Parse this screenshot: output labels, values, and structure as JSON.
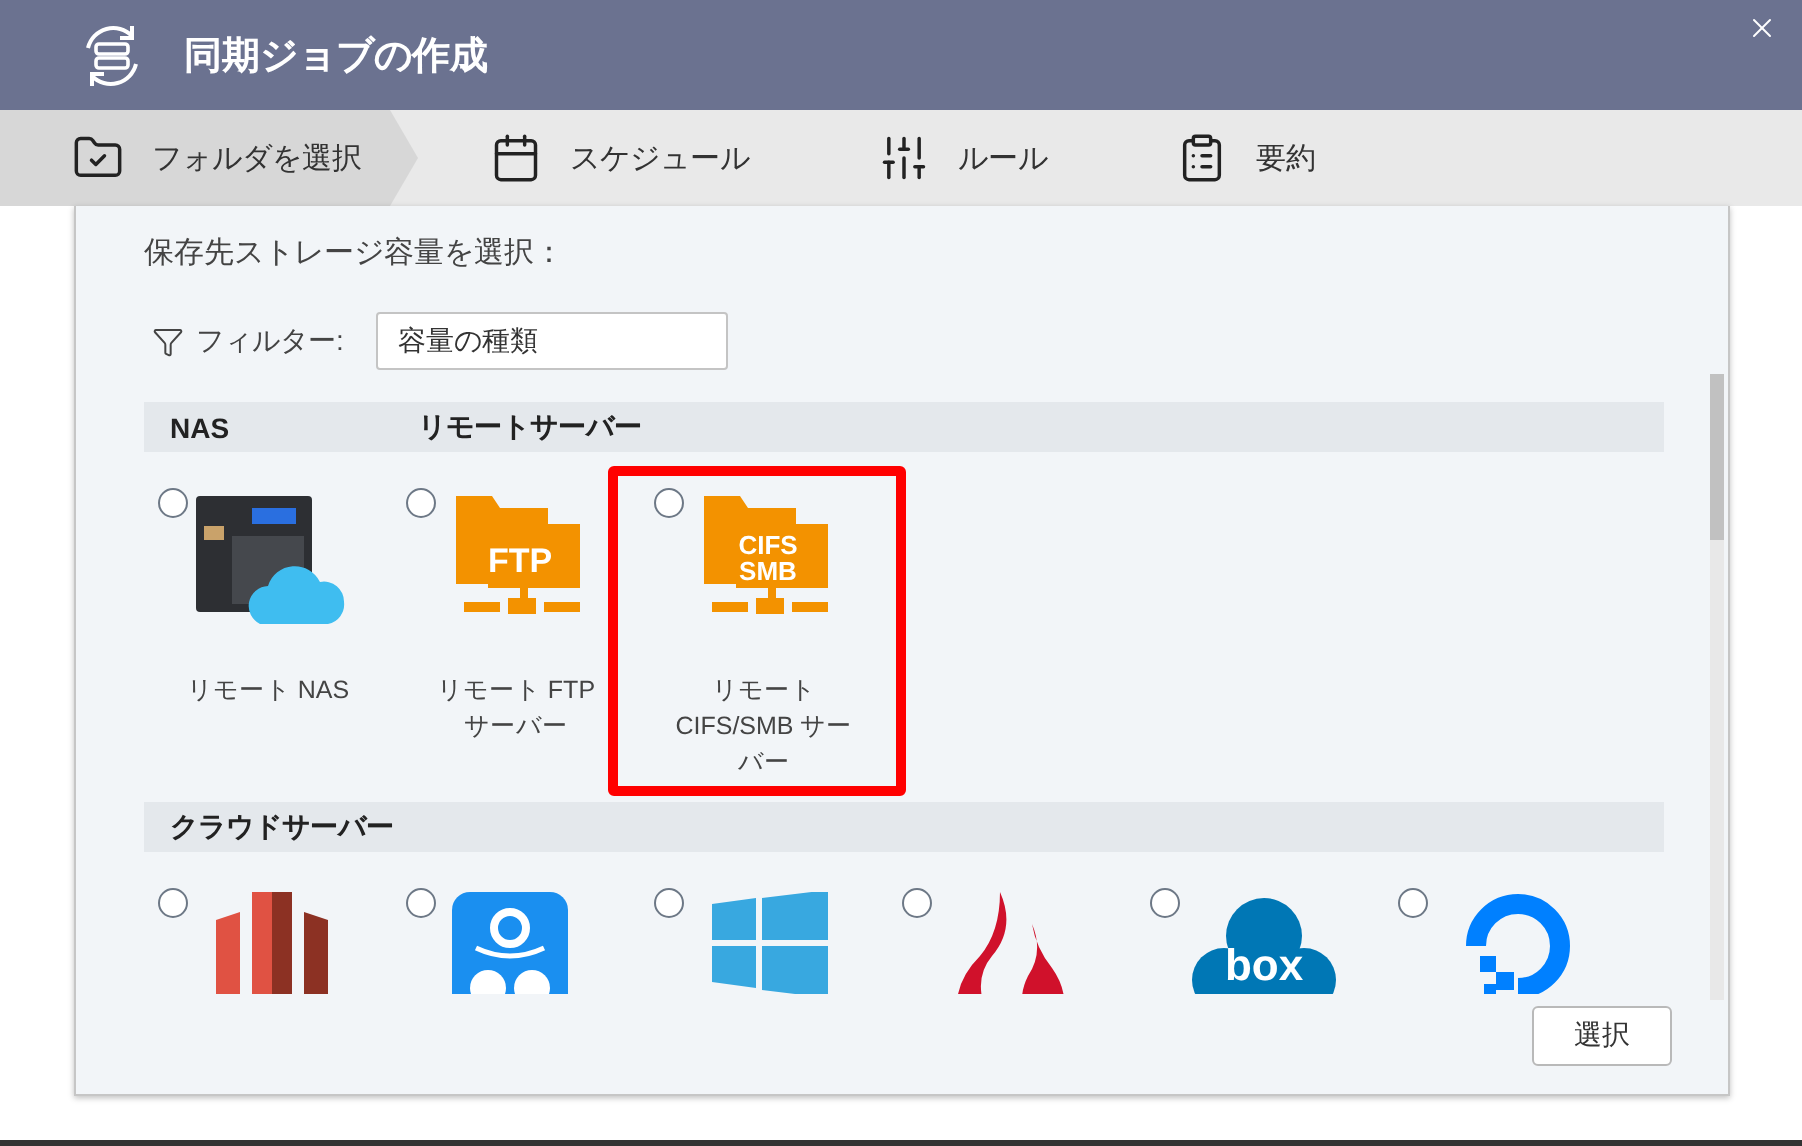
{
  "window": {
    "title": "同期ジョブの作成"
  },
  "steps": [
    {
      "kind": "folder",
      "label": "フォルダを選択",
      "selected": true
    },
    {
      "kind": "calendar",
      "label": "スケジュール",
      "selected": false
    },
    {
      "kind": "sliders",
      "label": "ルール",
      "selected": false
    },
    {
      "kind": "summary",
      "label": "要約",
      "selected": false
    }
  ],
  "prompt": "保存先ストレージ容量を選択：",
  "filter": {
    "label": "フィルター:",
    "value": "容量の種類"
  },
  "sections": [
    {
      "headers": [
        "NAS",
        "リモートサーバー"
      ],
      "items": [
        {
          "kind": "nas",
          "label": "リモート NAS",
          "selected": false
        },
        {
          "kind": "ftp",
          "icon_text": "FTP",
          "label": "リモート FTP サーバー",
          "selected": false
        },
        {
          "kind": "smb",
          "icon_text": "CIFS\nSMB",
          "label": "リモート\nCIFS/SMB サーバー",
          "selected": false,
          "highlighted": true
        }
      ]
    },
    {
      "headers": [
        "クラウドサーバー"
      ],
      "items": [
        {
          "kind": "s3",
          "selected": false
        },
        {
          "kind": "amazon",
          "selected": false
        },
        {
          "kind": "azure",
          "selected": false
        },
        {
          "kind": "backblaze",
          "selected": false
        },
        {
          "kind": "box",
          "icon_text": "box",
          "selected": false
        },
        {
          "kind": "digitalocean",
          "selected": false
        }
      ]
    }
  ],
  "button": "選択"
}
